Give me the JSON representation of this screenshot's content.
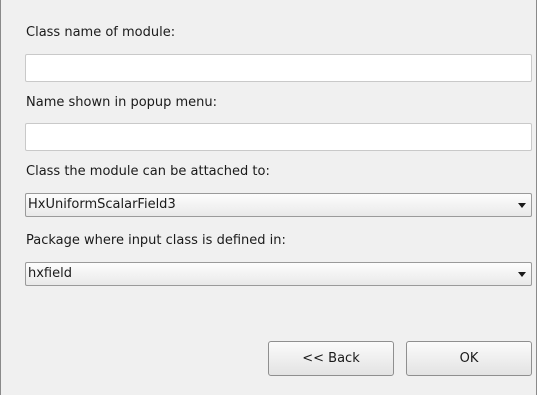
{
  "form": {
    "class_name_label": "Class name of module:",
    "class_name_value": "",
    "popup_name_label": "Name shown in popup menu:",
    "popup_name_value": "",
    "attach_class_label": "Class the module can be attached to:",
    "attach_class_selected": "HxUniformScalarField3",
    "package_label": "Package where input class is defined in:",
    "package_selected": "hxfield"
  },
  "buttons": {
    "back_label": "<< Back",
    "ok_label": "OK"
  }
}
